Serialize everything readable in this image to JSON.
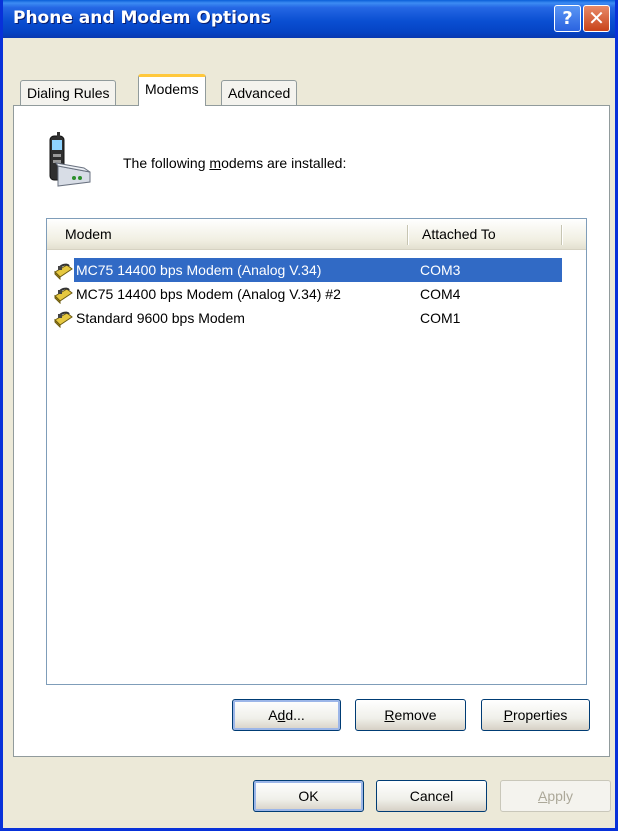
{
  "window": {
    "title": "Phone and Modem Options"
  },
  "titlebar": {
    "help_glyph": "?",
    "close_glyph": "✕"
  },
  "tabs": [
    {
      "label": "Dialing Rules",
      "active": false
    },
    {
      "label": "Modems",
      "active": true
    },
    {
      "label": "Advanced",
      "active": false
    }
  ],
  "modems_page": {
    "intro_prefix": "The following ",
    "intro_mnemonic": "m",
    "intro_suffix": "odems are  installed:",
    "icon": "phone-modem-icon"
  },
  "list": {
    "columns": [
      "Modem",
      "Attached To"
    ],
    "rows": [
      {
        "name": "MC75 14400 bps Modem (Analog V.34)",
        "port": "COM3",
        "selected": true
      },
      {
        "name": "MC75 14400 bps Modem (Analog V.34) #2",
        "port": "COM4",
        "selected": false
      },
      {
        "name": "Standard  9600 bps Modem",
        "port": "COM1",
        "selected": false
      }
    ]
  },
  "page_buttons": {
    "add": {
      "pre": "A",
      "mn": "d",
      "post": "d..."
    },
    "remove": {
      "pre": "",
      "mn": "R",
      "post": "emove"
    },
    "properties": {
      "pre": "",
      "mn": "P",
      "post": "roperties"
    }
  },
  "dialog_buttons": {
    "ok": "OK",
    "cancel": "Cancel",
    "apply": {
      "pre": "",
      "mn": "A",
      "post": "pply",
      "enabled": false
    }
  },
  "colors": {
    "selection": "#316ac5",
    "titlebar": "#0a4fd2",
    "face": "#ece9d8"
  }
}
